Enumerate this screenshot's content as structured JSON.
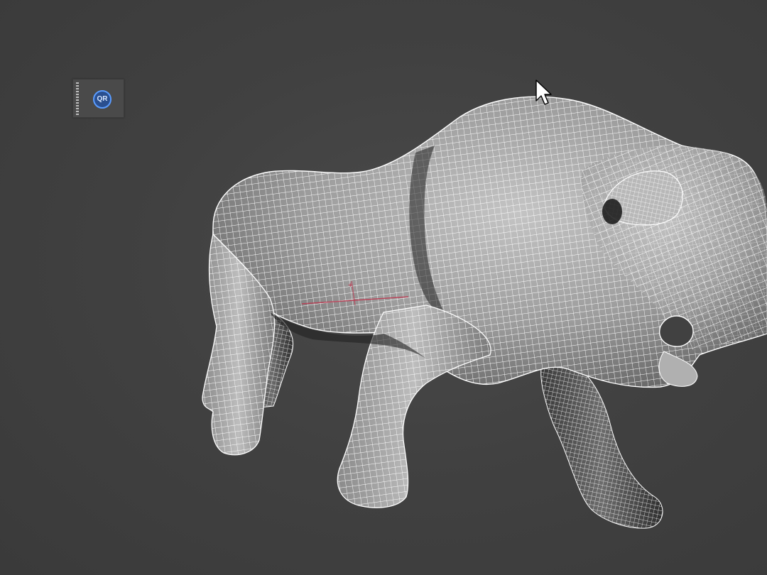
{
  "toolbar": {
    "qr_label": "QR",
    "qr_icon": "quad-remesher-icon",
    "accent_color": "#5a9cff"
  },
  "model": {
    "name": "bull",
    "display_mode": "wireframe-over-shaded"
  },
  "colors": {
    "viewport_bg": "#414141",
    "mesh_shade": "#9a9a9a",
    "wire": "#ffffff",
    "pivot_gizmo": "#c0304a"
  }
}
